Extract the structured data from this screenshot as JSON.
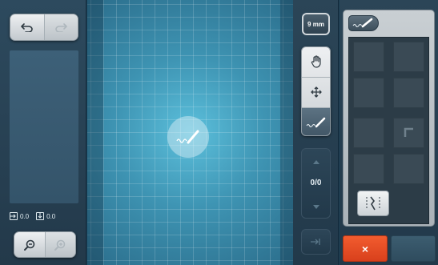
{
  "left_panel": {
    "undo_button": {
      "icon": "undo-icon",
      "enabled": true
    },
    "redo_button": {
      "icon": "redo-icon",
      "enabled": false
    },
    "coords": {
      "x_icon": "horizontal-offset-icon",
      "x_value": "0.0",
      "y_icon": "vertical-offset-icon",
      "y_value": "0.0"
    },
    "zoom_out_button": {
      "icon": "zoom-out-icon",
      "enabled": true
    },
    "zoom_in_button": {
      "icon": "zoom-in-icon",
      "enabled": false
    }
  },
  "canvas": {
    "center_marker_icon": "straight-stitch-icon"
  },
  "tools": {
    "stitch_length_label": "9 mm",
    "items": [
      {
        "icon": "hand-icon",
        "active": false
      },
      {
        "icon": "move-arrows-icon",
        "active": false
      },
      {
        "icon": "straight-stitch-icon",
        "active": true
      }
    ],
    "nav_up_icon": "chevron-up-icon",
    "stitch_counter": "0/0",
    "nav_down_icon": "chevron-down-icon",
    "jump_icon": "jump-stitch-icon"
  },
  "right_panel": {
    "tab_icon": "straight-stitch-icon",
    "selector_icon": "stitch-selector-icon",
    "cancel_label": "×",
    "colors": {
      "accent_cancel": "#e44c23",
      "canvas": "#4aa7c6",
      "panel": "#2b4557"
    }
  }
}
